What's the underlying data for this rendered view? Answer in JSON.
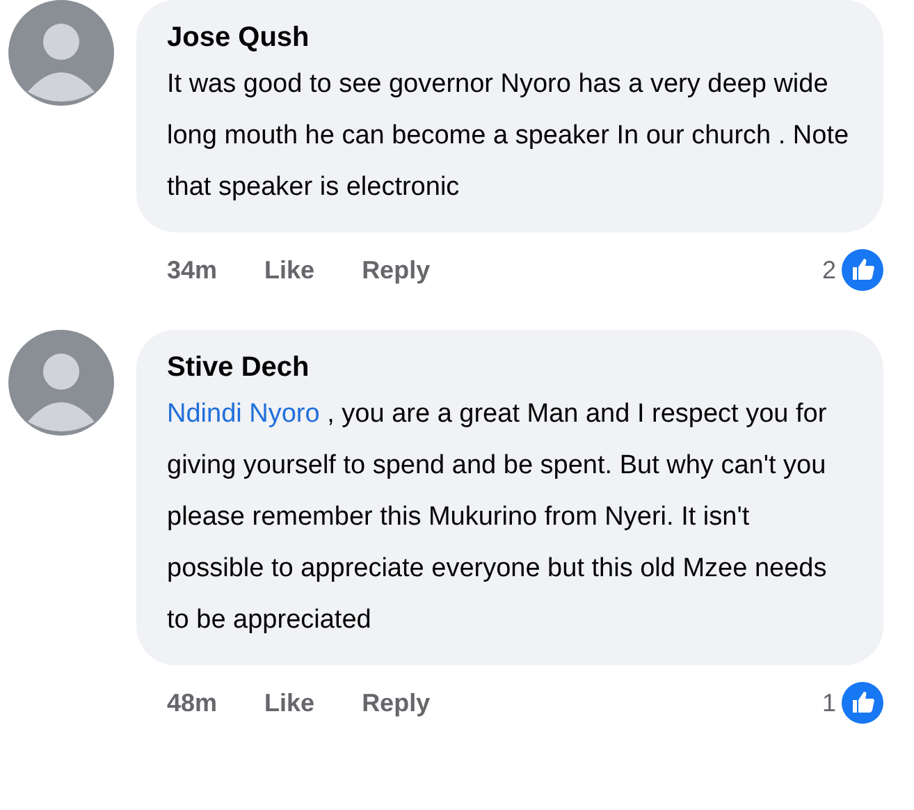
{
  "comments": [
    {
      "author": "Jose Qush",
      "body": [
        {
          "kind": "text",
          "text": "It was good to see governor Nyoro has a very deep wide long mouth  he can become a speaker In our church . Note that speaker is electronic"
        }
      ],
      "time": "34m",
      "like": "Like",
      "reply": "Reply",
      "reaction_count": "2"
    },
    {
      "author": "Stive Dech",
      "body": [
        {
          "kind": "mention",
          "text": "Ndindi Nyoro"
        },
        {
          "kind": "text",
          "text": " , you are a great Man and I respect you for giving yourself to spend and be spent. But why can't you please remember this Mukurino from Nyeri. It isn't possible to appreciate everyone but this old Mzee needs to be appreciated"
        }
      ],
      "time": "48m",
      "like": "Like",
      "reply": "Reply",
      "reaction_count": "1"
    }
  ]
}
